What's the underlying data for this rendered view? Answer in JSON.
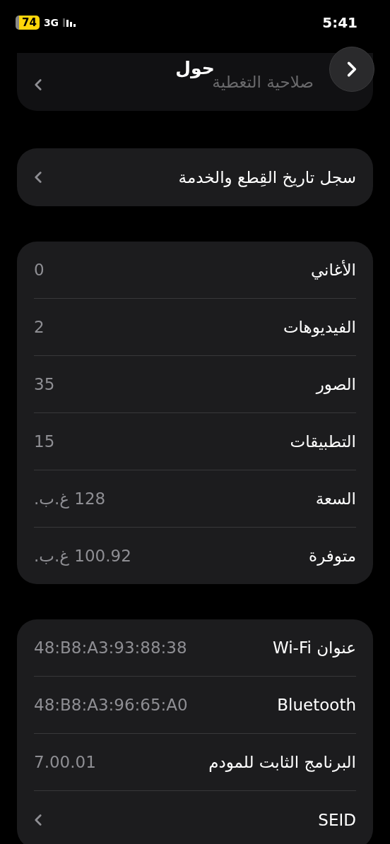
{
  "status_bar": {
    "battery": "74",
    "network": "3G",
    "time": "5:41"
  },
  "header": {
    "title": "حول"
  },
  "scrolled_row": {
    "label": "صلاحية التغطية"
  },
  "history_row": {
    "label": "سجل تاريخ القِطع والخدمة"
  },
  "media_stats": [
    {
      "label": "الأغاني",
      "value": "0"
    },
    {
      "label": "الفيديوهات",
      "value": "2"
    },
    {
      "label": "الصور",
      "value": "35"
    },
    {
      "label": "التطبيقات",
      "value": "15"
    },
    {
      "label": "السعة",
      "value": "128 غ.ب."
    },
    {
      "label": "متوفرة",
      "value": "100.92 غ.ب."
    }
  ],
  "device_info": [
    {
      "kind": "value",
      "label": "عنوان Wi-Fi",
      "value": "48:B8:A3:93:88:38"
    },
    {
      "kind": "value",
      "label": "Bluetooth",
      "value": "48:B8:A3:96:65:A0"
    },
    {
      "kind": "value",
      "label": "البرنامج الثابت للمودم",
      "value": "7.00.01"
    },
    {
      "kind": "link",
      "label": "SEID"
    }
  ]
}
